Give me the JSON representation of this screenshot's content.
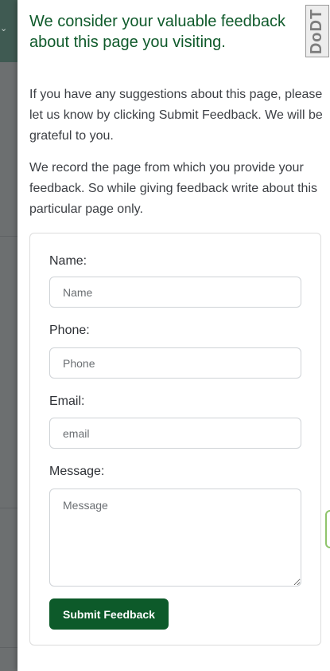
{
  "drawer": {
    "heading": "We consider your valuable feedback about this page you visiting.",
    "badge_text": "DoDT",
    "paragraphs": [
      "If you have any suggestions about this page, please let us know by clicking Submit Feedback. We will be grateful to you.",
      "We record the page from which you provide your feedback. So while giving feedback write about this particular page only."
    ]
  },
  "form": {
    "name": {
      "label": "Name:",
      "placeholder": "Name",
      "value": ""
    },
    "phone": {
      "label": "Phone:",
      "placeholder": "Phone",
      "value": ""
    },
    "email": {
      "label": "Email:",
      "placeholder": "email",
      "value": ""
    },
    "message": {
      "label": "Message:",
      "placeholder": "Message",
      "value": ""
    },
    "submit_label": "Submit Feedback"
  },
  "icons": {
    "backdrop_chevron": "chevron-down-icon"
  },
  "colors": {
    "heading": "#0f5a2b",
    "button": "#0d5a2a",
    "edge_tab_border": "#8fc46b"
  }
}
